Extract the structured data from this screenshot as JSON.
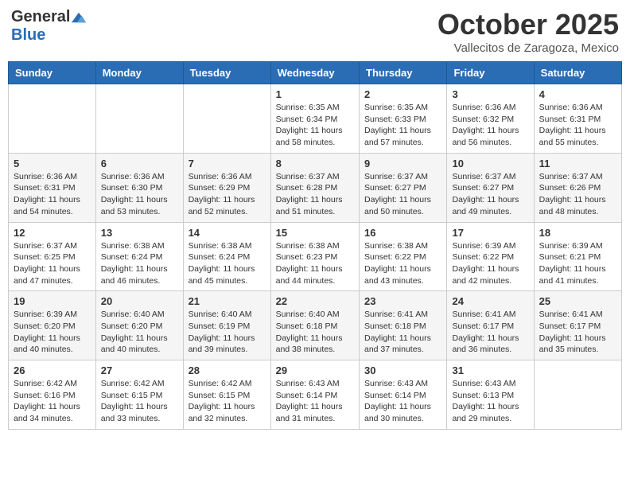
{
  "logo": {
    "general": "General",
    "blue": "Blue"
  },
  "title": "October 2025",
  "subtitle": "Vallecitos de Zaragoza, Mexico",
  "days_header": [
    "Sunday",
    "Monday",
    "Tuesday",
    "Wednesday",
    "Thursday",
    "Friday",
    "Saturday"
  ],
  "weeks": [
    [
      {
        "day": "",
        "info": ""
      },
      {
        "day": "",
        "info": ""
      },
      {
        "day": "",
        "info": ""
      },
      {
        "day": "1",
        "info": "Sunrise: 6:35 AM\nSunset: 6:34 PM\nDaylight: 11 hours\nand 58 minutes."
      },
      {
        "day": "2",
        "info": "Sunrise: 6:35 AM\nSunset: 6:33 PM\nDaylight: 11 hours\nand 57 minutes."
      },
      {
        "day": "3",
        "info": "Sunrise: 6:36 AM\nSunset: 6:32 PM\nDaylight: 11 hours\nand 56 minutes."
      },
      {
        "day": "4",
        "info": "Sunrise: 6:36 AM\nSunset: 6:31 PM\nDaylight: 11 hours\nand 55 minutes."
      }
    ],
    [
      {
        "day": "5",
        "info": "Sunrise: 6:36 AM\nSunset: 6:31 PM\nDaylight: 11 hours\nand 54 minutes."
      },
      {
        "day": "6",
        "info": "Sunrise: 6:36 AM\nSunset: 6:30 PM\nDaylight: 11 hours\nand 53 minutes."
      },
      {
        "day": "7",
        "info": "Sunrise: 6:36 AM\nSunset: 6:29 PM\nDaylight: 11 hours\nand 52 minutes."
      },
      {
        "day": "8",
        "info": "Sunrise: 6:37 AM\nSunset: 6:28 PM\nDaylight: 11 hours\nand 51 minutes."
      },
      {
        "day": "9",
        "info": "Sunrise: 6:37 AM\nSunset: 6:27 PM\nDaylight: 11 hours\nand 50 minutes."
      },
      {
        "day": "10",
        "info": "Sunrise: 6:37 AM\nSunset: 6:27 PM\nDaylight: 11 hours\nand 49 minutes."
      },
      {
        "day": "11",
        "info": "Sunrise: 6:37 AM\nSunset: 6:26 PM\nDaylight: 11 hours\nand 48 minutes."
      }
    ],
    [
      {
        "day": "12",
        "info": "Sunrise: 6:37 AM\nSunset: 6:25 PM\nDaylight: 11 hours\nand 47 minutes."
      },
      {
        "day": "13",
        "info": "Sunrise: 6:38 AM\nSunset: 6:24 PM\nDaylight: 11 hours\nand 46 minutes."
      },
      {
        "day": "14",
        "info": "Sunrise: 6:38 AM\nSunset: 6:24 PM\nDaylight: 11 hours\nand 45 minutes."
      },
      {
        "day": "15",
        "info": "Sunrise: 6:38 AM\nSunset: 6:23 PM\nDaylight: 11 hours\nand 44 minutes."
      },
      {
        "day": "16",
        "info": "Sunrise: 6:38 AM\nSunset: 6:22 PM\nDaylight: 11 hours\nand 43 minutes."
      },
      {
        "day": "17",
        "info": "Sunrise: 6:39 AM\nSunset: 6:22 PM\nDaylight: 11 hours\nand 42 minutes."
      },
      {
        "day": "18",
        "info": "Sunrise: 6:39 AM\nSunset: 6:21 PM\nDaylight: 11 hours\nand 41 minutes."
      }
    ],
    [
      {
        "day": "19",
        "info": "Sunrise: 6:39 AM\nSunset: 6:20 PM\nDaylight: 11 hours\nand 40 minutes."
      },
      {
        "day": "20",
        "info": "Sunrise: 6:40 AM\nSunset: 6:20 PM\nDaylight: 11 hours\nand 40 minutes."
      },
      {
        "day": "21",
        "info": "Sunrise: 6:40 AM\nSunset: 6:19 PM\nDaylight: 11 hours\nand 39 minutes."
      },
      {
        "day": "22",
        "info": "Sunrise: 6:40 AM\nSunset: 6:18 PM\nDaylight: 11 hours\nand 38 minutes."
      },
      {
        "day": "23",
        "info": "Sunrise: 6:41 AM\nSunset: 6:18 PM\nDaylight: 11 hours\nand 37 minutes."
      },
      {
        "day": "24",
        "info": "Sunrise: 6:41 AM\nSunset: 6:17 PM\nDaylight: 11 hours\nand 36 minutes."
      },
      {
        "day": "25",
        "info": "Sunrise: 6:41 AM\nSunset: 6:17 PM\nDaylight: 11 hours\nand 35 minutes."
      }
    ],
    [
      {
        "day": "26",
        "info": "Sunrise: 6:42 AM\nSunset: 6:16 PM\nDaylight: 11 hours\nand 34 minutes."
      },
      {
        "day": "27",
        "info": "Sunrise: 6:42 AM\nSunset: 6:15 PM\nDaylight: 11 hours\nand 33 minutes."
      },
      {
        "day": "28",
        "info": "Sunrise: 6:42 AM\nSunset: 6:15 PM\nDaylight: 11 hours\nand 32 minutes."
      },
      {
        "day": "29",
        "info": "Sunrise: 6:43 AM\nSunset: 6:14 PM\nDaylight: 11 hours\nand 31 minutes."
      },
      {
        "day": "30",
        "info": "Sunrise: 6:43 AM\nSunset: 6:14 PM\nDaylight: 11 hours\nand 30 minutes."
      },
      {
        "day": "31",
        "info": "Sunrise: 6:43 AM\nSunset: 6:13 PM\nDaylight: 11 hours\nand 29 minutes."
      },
      {
        "day": "",
        "info": ""
      }
    ]
  ]
}
